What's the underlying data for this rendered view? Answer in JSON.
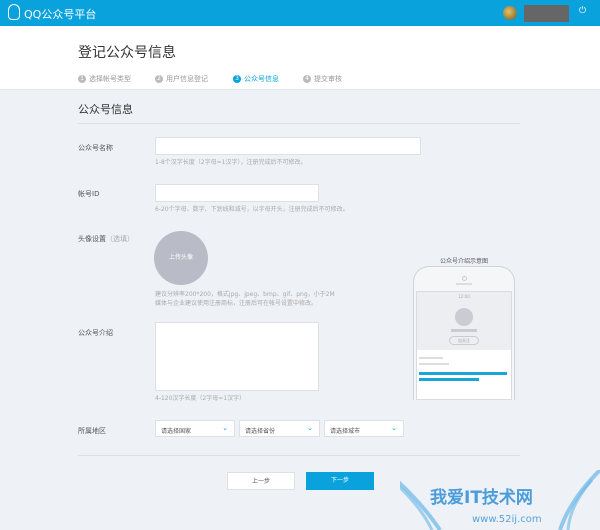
{
  "topbar": {
    "brand": "QQ公众号平台",
    "power_icon": "power-icon"
  },
  "header": {
    "title": "登记公众号信息",
    "steps": [
      {
        "num": "1",
        "label": "选择帐号类型"
      },
      {
        "num": "2",
        "label": "用户信息登记"
      },
      {
        "num": "3",
        "label": "公众号信息"
      },
      {
        "num": "4",
        "label": "提交审核"
      }
    ]
  },
  "form": {
    "section_title": "公众号信息",
    "name": {
      "label": "公众号名称",
      "value": "",
      "hint": "1-8个汉字长度（2字母=1汉字），注册完成后不可修改。"
    },
    "account_id": {
      "label": "帐号ID",
      "value": "",
      "hint": "6-20个字母、数字、下划线和减号，以字母开头，注册完成后不可修改。"
    },
    "avatar": {
      "label": "头像设置",
      "optional": "（选填）",
      "upload_label": "上传头像",
      "hint1": "建议分辨率200*200，格式jpg、jpeg、bmp、gif、png，小于2M",
      "hint2": "媒体与企业建议使用注册商标，注册后可在帐号设置中修改。"
    },
    "intro": {
      "label": "公众号介绍",
      "value": "",
      "hint": "4-120汉字长度（2字母=1汉字）"
    },
    "region": {
      "label": "所属地区",
      "country": "请选择国家",
      "province": "请选择省份",
      "city": "请选择城市"
    },
    "prev": "上一步",
    "next": "下一步"
  },
  "preview": {
    "title": "公众号介绍示意图",
    "time": "12:00",
    "follow": "加关注"
  },
  "watermark": {
    "text": "我爱IT技术网",
    "url": "www.52ij.com"
  }
}
